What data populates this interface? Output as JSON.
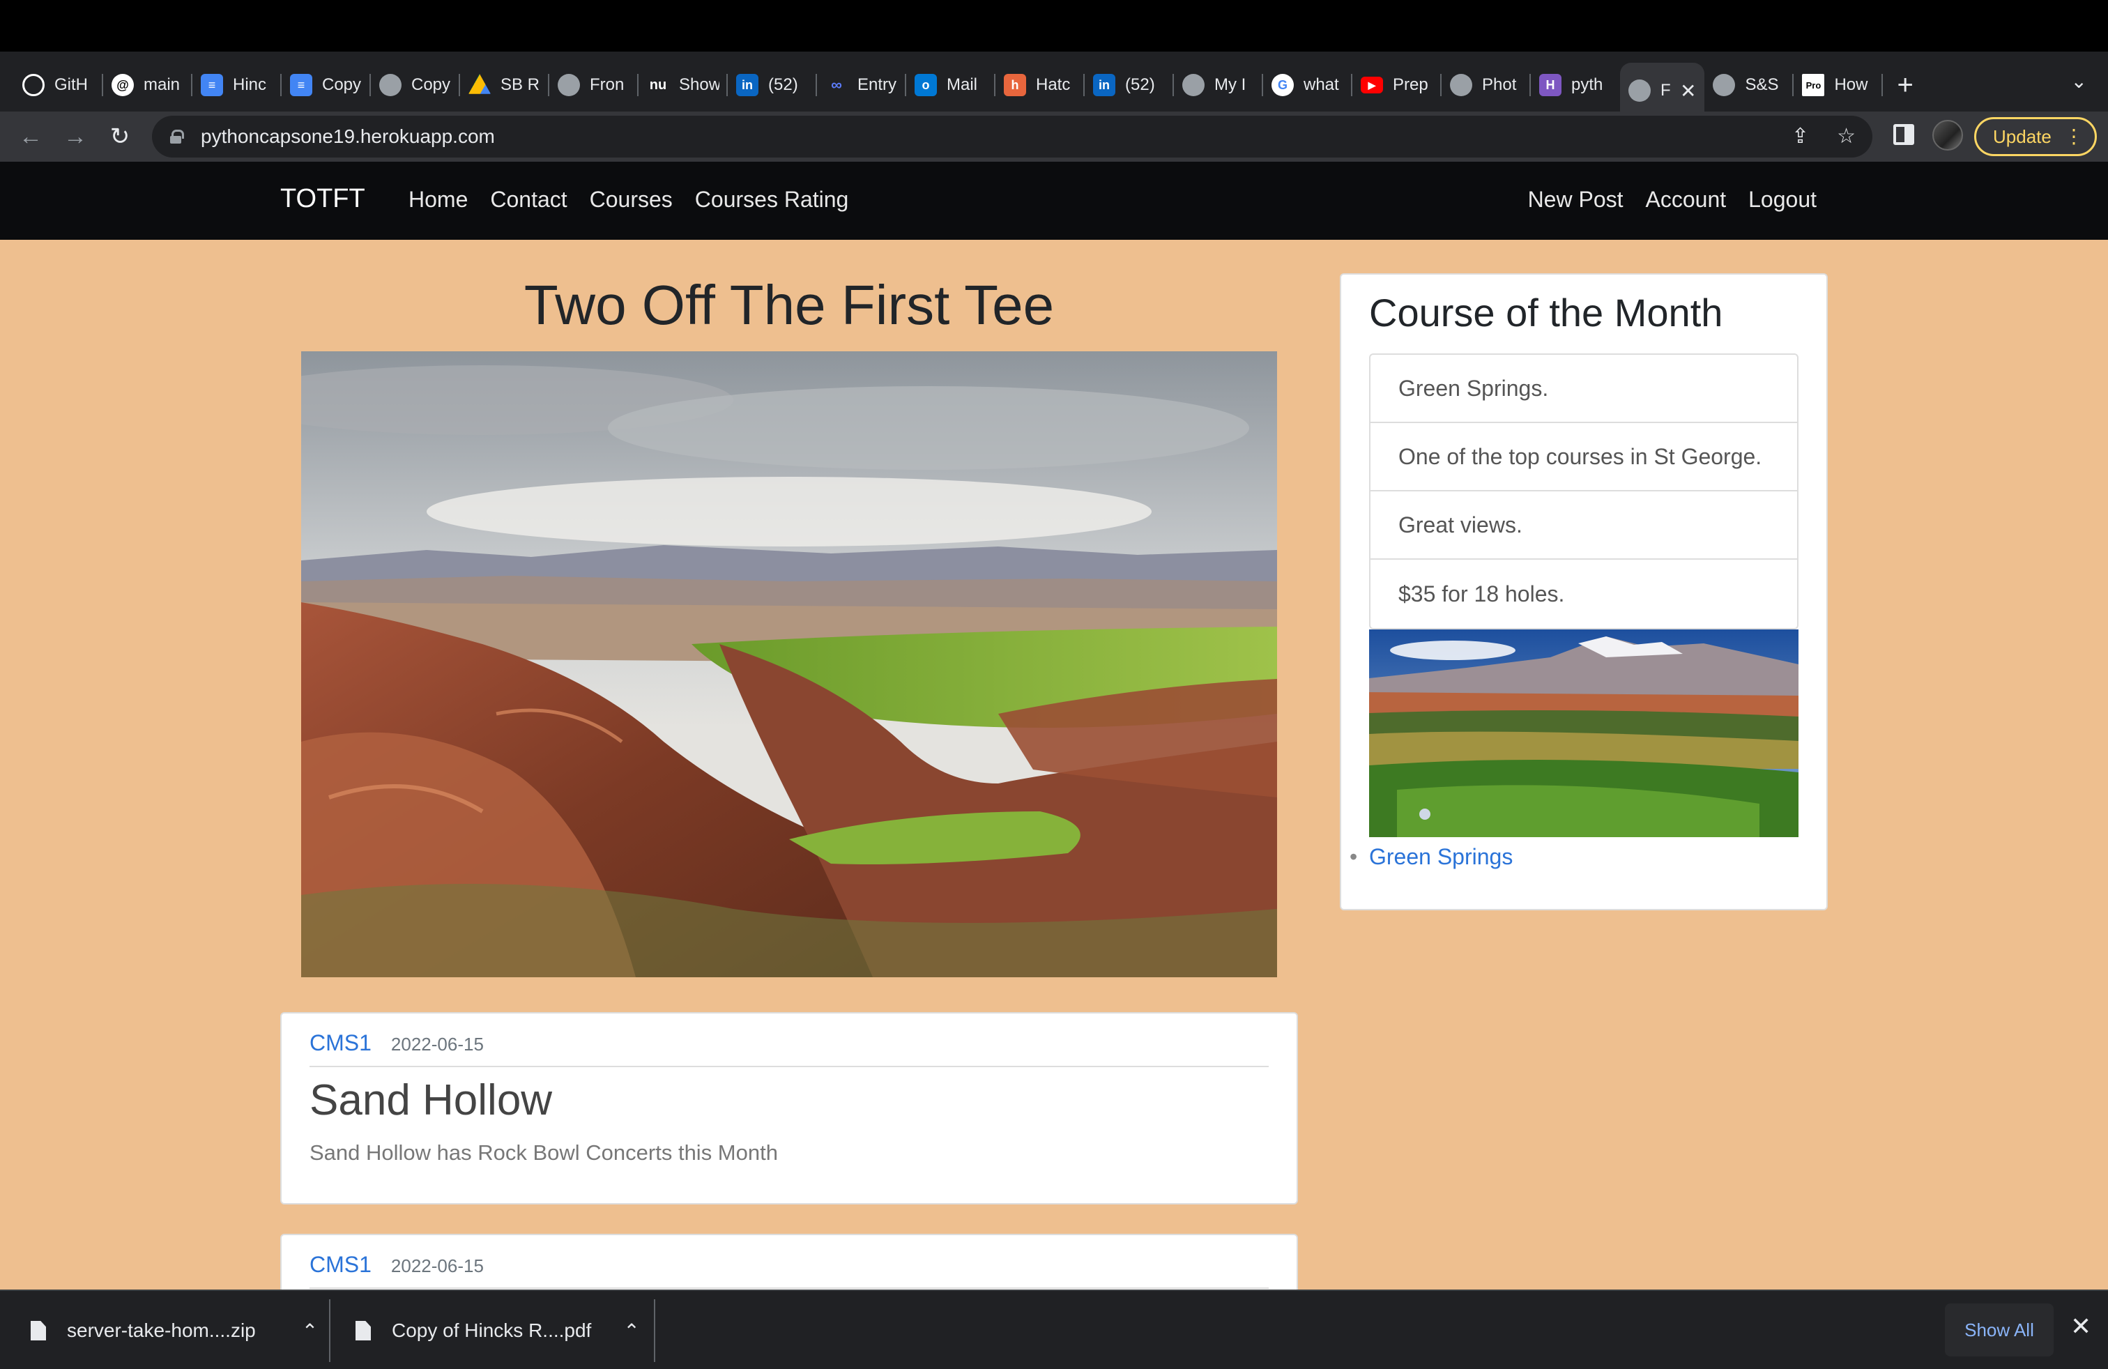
{
  "browser": {
    "tabs": [
      {
        "label": "GitH",
        "icon": "github-icon",
        "color": "#ffffff"
      },
      {
        "label": "main",
        "icon": "threads-icon",
        "color": "#ffffff"
      },
      {
        "label": "Hinc",
        "icon": "docs-icon",
        "color": "#4285f4"
      },
      {
        "label": "Copy",
        "icon": "docs-icon",
        "color": "#4285f4"
      },
      {
        "label": "Copy",
        "icon": "globe-icon",
        "color": "#9aa0a6"
      },
      {
        "label": "SB R",
        "icon": "drive-icon",
        "color": "#fbbc04"
      },
      {
        "label": "Fron",
        "icon": "globe-icon",
        "color": "#9aa0a6"
      },
      {
        "label": "Show",
        "icon": "nu-icon",
        "color": "#202124"
      },
      {
        "label": "(52)",
        "icon": "linkedin-icon",
        "color": "#0a66c2"
      },
      {
        "label": "Entry",
        "icon": "link-icon",
        "color": "#3b5bdb"
      },
      {
        "label": "Mail",
        "icon": "outlook-icon",
        "color": "#0078d4"
      },
      {
        "label": "Hatc",
        "icon": "hatch-icon",
        "color": "#e8663d"
      },
      {
        "label": "(52)",
        "icon": "linkedin-icon",
        "color": "#0a66c2"
      },
      {
        "label": "My I",
        "icon": "globe-icon",
        "color": "#9aa0a6"
      },
      {
        "label": "what",
        "icon": "google-icon",
        "color": "#ffffff"
      },
      {
        "label": "Prep",
        "icon": "youtube-icon",
        "color": "#ff0000"
      },
      {
        "label": "Phot",
        "icon": "globe-icon",
        "color": "#9aa0a6"
      },
      {
        "label": "pyth",
        "icon": "h-icon",
        "color": "#7e57c2"
      },
      {
        "label": "F",
        "icon": "globe-icon",
        "color": "#9aa0a6",
        "active": true
      },
      {
        "label": "S&S",
        "icon": "globe-icon",
        "color": "#9aa0a6"
      },
      {
        "label": "How",
        "icon": "pro-icon",
        "color": "#ffffff"
      }
    ],
    "url": "pythoncapsone19.herokuapp.com",
    "update_label": "Update"
  },
  "site": {
    "brand": "TOTFT",
    "nav_left": [
      "Home",
      "Contact",
      "Courses",
      "Courses Rating"
    ],
    "nav_right": [
      "New Post",
      "Account",
      "Logout"
    ],
    "heading": "Two Off The First Tee"
  },
  "posts": [
    {
      "author": "CMS1",
      "date": "2022-06-15",
      "title": "Sand Hollow",
      "content": "Sand Hollow has Rock Bowl Concerts this Month"
    },
    {
      "author": "CMS1",
      "date": "2022-06-15"
    }
  ],
  "sidebar": {
    "title": "Course of the Month",
    "items": [
      "Green Springs.",
      "One of the top courses in St George.",
      "Great views.",
      "$35 for 18 holes."
    ],
    "link": "Green Springs"
  },
  "downloads": {
    "files": [
      "server-take-hom....zip",
      "Copy of Hincks R....pdf"
    ],
    "show_all": "Show All"
  },
  "colors": {
    "page_background": "#eebf8f",
    "navbar": "#0b0c0e",
    "link": "#2a73d8",
    "update_accent": "#fdd663"
  }
}
